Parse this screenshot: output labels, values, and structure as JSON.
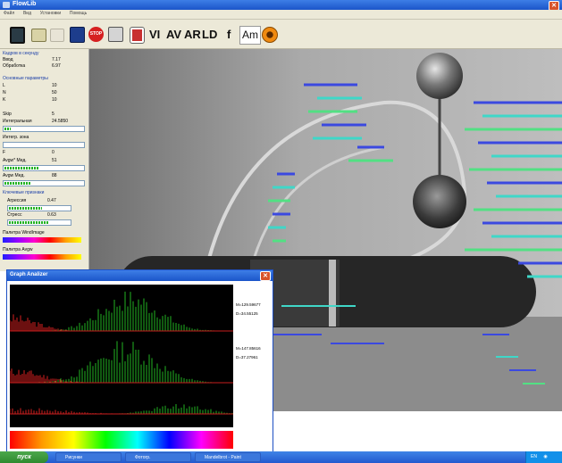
{
  "window": {
    "title": "FlowLib"
  },
  "menu": [
    "Файл",
    "Вид",
    "Установки",
    "Помощь"
  ],
  "toolbar": {
    "text_buttons": [
      "VI",
      "AV",
      "AR",
      "LD",
      "f",
      "Am"
    ]
  },
  "panel": {
    "fps_section": "Кадров в секунду",
    "fps_rows": [
      {
        "label": "Ввод",
        "value": "7.17"
      },
      {
        "label": "Обработка",
        "value": "6.97"
      }
    ],
    "main_section": "Основные параметры",
    "main_rows": [
      {
        "label": "L",
        "value": "10"
      },
      {
        "label": "N",
        "value": "50"
      },
      {
        "label": "K",
        "value": "10"
      }
    ],
    "skip": {
      "label": "Skip",
      "value": "5"
    },
    "integral": {
      "label": "Интегральная",
      "value": "24.5850",
      "level": 0.08
    },
    "integr_zone": {
      "label": "Интегр. зона"
    },
    "f": {
      "label": "F",
      "value": "0"
    },
    "avgmed": {
      "label": "Avgw* Мед.",
      "value": "51",
      "level": 0.45
    },
    "avgw": {
      "label": "Avgw Мед.",
      "value": "88",
      "level": 0.35
    },
    "features_section": "Ключевые признаки",
    "agression": {
      "label": "Агрессия",
      "value": "0.47",
      "level": 0.55
    },
    "stress": {
      "label": "Стресс",
      "value": "0.63",
      "level": 0.65
    },
    "palette_window": "Палитра WindImage",
    "palette_avgw": "Палитра Avgw"
  },
  "graph_window": {
    "title": "Graph Analizer",
    "stats": [
      {
        "m": "M=129.59677",
        "d": "D=34.55125"
      },
      {
        "m": "M=147.85616",
        "d": "D=37.27961"
      }
    ]
  },
  "taskbar": {
    "start": "пуск",
    "tasks": [
      "Рисунки",
      "Фотогр.",
      "Mandelbrot - Paint"
    ],
    "tray_lang": "EN"
  },
  "colors": {
    "flow_blue": "#3b49e0",
    "flow_cyan": "#3fd7c8",
    "flow_green": "#52e083",
    "graph_red": "#d82020",
    "graph_green": "#22b322"
  }
}
